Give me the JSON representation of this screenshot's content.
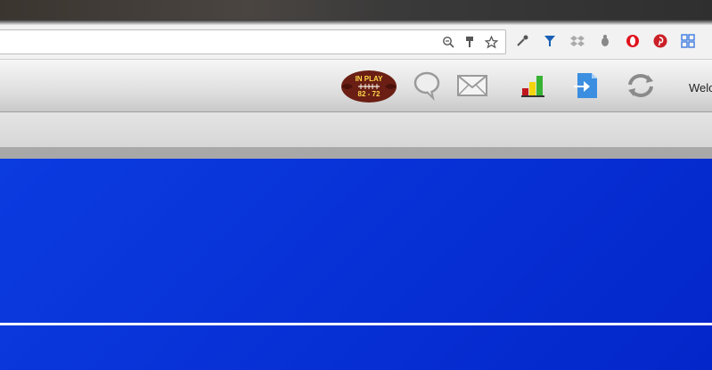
{
  "browser": {
    "omnibox_icons": [
      "zoom-icon",
      "brush-icon",
      "star-icon"
    ],
    "extension_icons": [
      "eyedropper-icon",
      "filter-icon",
      "dropbox-icon",
      "bug-icon",
      "opera-icon",
      "pinterest-icon",
      "grid-icon"
    ]
  },
  "app": {
    "badge": {
      "line1": "IN PLAY",
      "line2": "82 - 72"
    },
    "icons": [
      "chat-icon",
      "mail-icon",
      "stats-icon",
      "login-icon",
      "sync-icon"
    ],
    "welcome_text": "Welc"
  },
  "colors": {
    "content_blue": "#0a33d8",
    "badge_text": "#ffd84a",
    "football_brown": "#6b1f14"
  }
}
